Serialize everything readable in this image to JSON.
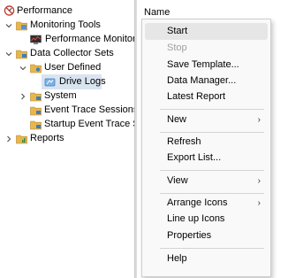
{
  "tree": {
    "root": {
      "label": "Performance"
    },
    "monitoring_tools": {
      "label": "Monitoring Tools"
    },
    "performance_monitor": {
      "label": "Performance Monitor"
    },
    "data_collector_sets": {
      "label": "Data Collector Sets"
    },
    "user_defined": {
      "label": "User Defined"
    },
    "drive_logs": {
      "label": "Drive Logs",
      "selected": true
    },
    "system": {
      "label": "System"
    },
    "event_trace_sessions": {
      "label": "Event Trace Sessions"
    },
    "startup_event_trace": {
      "label": "Startup Event Trace Ses"
    },
    "reports": {
      "label": "Reports"
    }
  },
  "list": {
    "column_header": "Name"
  },
  "context_menu": {
    "start": "Start",
    "stop": "Stop",
    "save_template": "Save Template...",
    "data_manager": "Data Manager...",
    "latest_report": "Latest Report",
    "new": "New",
    "refresh": "Refresh",
    "export_list": "Export List...",
    "view": "View",
    "arrange_icons": "Arrange Icons",
    "line_up_icons": "Line up Icons",
    "properties": "Properties",
    "help": "Help",
    "submenu_arrow": "›"
  },
  "colors": {
    "selection": "#d9e4f1",
    "menu_hover": "#e6e6e6",
    "folder": "#e8b64a",
    "disabled_text": "#a0a0a0"
  },
  "icons": {
    "root": "performance-icon",
    "folder": "folder-icon",
    "monitor": "monitor-icon",
    "drive_logs": "data-collector-icon",
    "report": "report-folder-icon"
  }
}
